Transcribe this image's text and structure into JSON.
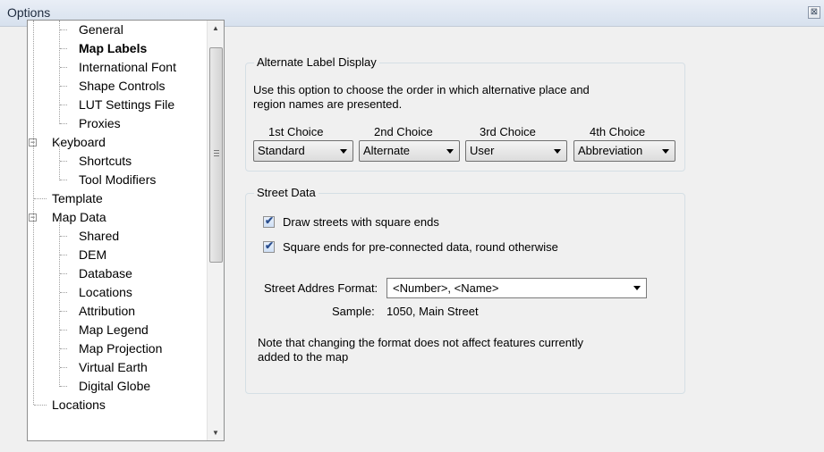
{
  "window": {
    "title": "Options",
    "close_glyph": "⊠"
  },
  "tree": {
    "items": [
      {
        "label": "General",
        "level": 2
      },
      {
        "label": "Map Labels",
        "level": 2,
        "bold": true
      },
      {
        "label": "International Font",
        "level": 2
      },
      {
        "label": "Shape Controls",
        "level": 2
      },
      {
        "label": "LUT Settings File",
        "level": 2
      },
      {
        "label": "Proxies",
        "level": 2
      },
      {
        "label": "Keyboard",
        "level": 1,
        "expander": "−"
      },
      {
        "label": "Shortcuts",
        "level": 2
      },
      {
        "label": "Tool Modifiers",
        "level": 2
      },
      {
        "label": "Template",
        "level": 1
      },
      {
        "label": "Map Data",
        "level": 1,
        "expander": "−"
      },
      {
        "label": "Shared",
        "level": 2
      },
      {
        "label": "DEM",
        "level": 2
      },
      {
        "label": "Database",
        "level": 2
      },
      {
        "label": "Locations",
        "level": 2
      },
      {
        "label": "Attribution",
        "level": 2
      },
      {
        "label": "Map Legend",
        "level": 2
      },
      {
        "label": "Map Projection",
        "level": 2
      },
      {
        "label": "Virtual Earth",
        "level": 2
      },
      {
        "label": "Digital Globe",
        "level": 2
      },
      {
        "label": "Locations",
        "level": 1
      }
    ],
    "scroll_up_glyph": "▲",
    "scroll_down_glyph": "▼"
  },
  "alternate_label": {
    "title": "Alternate Label Display",
    "description": "Use this option to choose the order in which alternative place and region names are presented.",
    "choices": [
      {
        "label": "1st Choice",
        "value": "Standard"
      },
      {
        "label": "2nd Choice",
        "value": "Alternate"
      },
      {
        "label": "3rd Choice",
        "value": "User"
      },
      {
        "label": "4th Choice",
        "value": "Abbreviation"
      }
    ]
  },
  "street_data": {
    "title": "Street Data",
    "checkbox_mark": "✔",
    "square_ends_label": "Draw streets with square ends",
    "square_ends_checked": true,
    "preconnected_label": "Square ends for pre-connected data, round otherwise",
    "preconnected_checked": true,
    "format_label": "Street Addres Format:",
    "format_value": "<Number>, <Name>",
    "sample_label": "Sample:",
    "sample_value": "1050, Main Street",
    "note": "Note that changing the format does not affect features currently added to the map"
  }
}
